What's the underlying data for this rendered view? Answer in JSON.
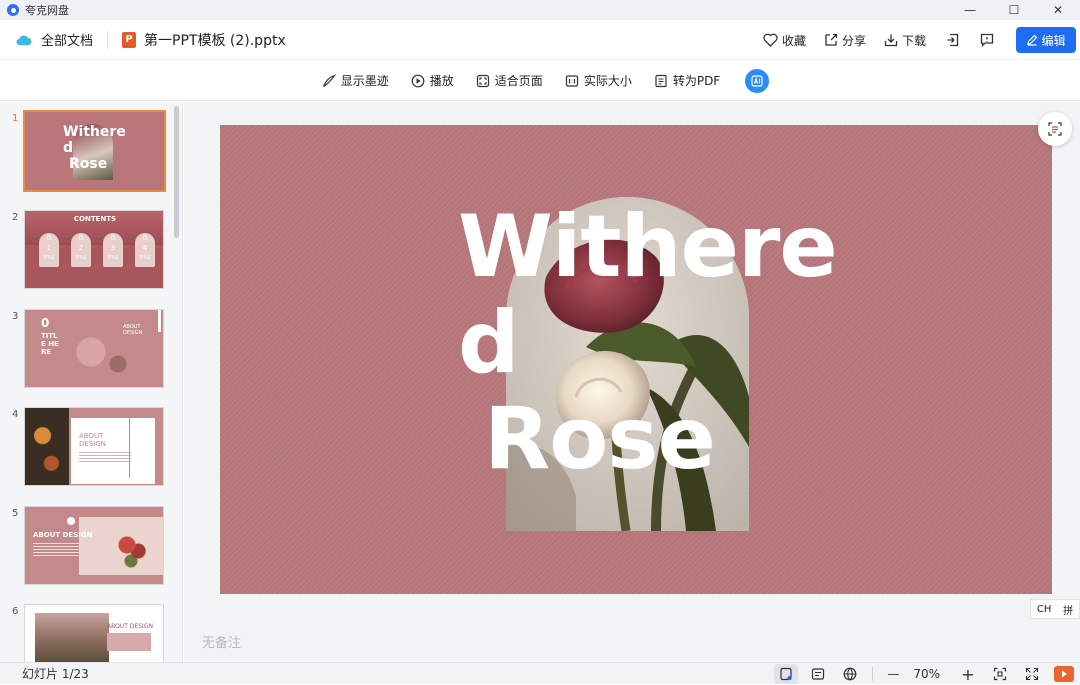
{
  "app": {
    "title": "夸克网盘"
  },
  "window_controls": {
    "minimize": "—",
    "maximize": "☐",
    "close": "✕"
  },
  "header": {
    "all_docs": "全部文档",
    "file_name": "第一PPT模板 (2).pptx",
    "file_badge": "P",
    "favorite": "收藏",
    "share": "分享",
    "download": "下载",
    "edit": "编辑"
  },
  "toolbar": {
    "show_ink": "显示墨迹",
    "play": "播放",
    "fit_page": "适合页面",
    "actual_size": "实际大小",
    "to_pdf": "转为PDF"
  },
  "thumbnails": [
    {
      "num": "1",
      "title_line1": "Withere",
      "title_line2": "d",
      "title_line3": "Rose",
      "active": true
    },
    {
      "num": "2",
      "heading": "CONTENTS",
      "items": [
        "1",
        "2",
        "3",
        "4"
      ],
      "item_labels": [
        "0",
        "0",
        "0",
        "0"
      ],
      "sub": [
        "TITLE",
        "TITLE",
        "TITLE",
        "TITLE"
      ]
    },
    {
      "num": "3",
      "left_text": "0",
      "title_a": "TITL",
      "title_b": "E HE",
      "title_c": "RE",
      "right_a": "ABOUT",
      "right_b": "DESIGN"
    },
    {
      "num": "4",
      "title_a": "ABOUT",
      "title_b": "DESIGN"
    },
    {
      "num": "5",
      "label": "ABOUT DESIGN"
    },
    {
      "num": "6",
      "label": "ABOUT DESIGN"
    }
  ],
  "slide": {
    "line1": "Withere",
    "line2": "d",
    "line3": "Rose"
  },
  "notes": {
    "placeholder": "无备注"
  },
  "ime": {
    "lang": "CH",
    "mode": "拼"
  },
  "status": {
    "slide_count": "幻灯片 1/23",
    "zoom": "70%",
    "zoom_out": "—",
    "zoom_in": "+"
  },
  "colors": {
    "accent": "#1d6cf2",
    "slide_bg": "#b7777b",
    "thumb_active_border": "#e98a3b",
    "ppt_badge": "#e8572a"
  }
}
